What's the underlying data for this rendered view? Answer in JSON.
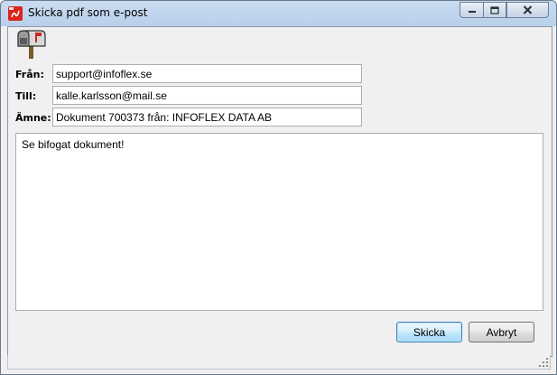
{
  "window": {
    "title": "Skicka pdf som e-post",
    "controls": {
      "minimize": "minimize-icon",
      "maximize": "maximize-icon",
      "close": "close-icon"
    }
  },
  "form": {
    "from_label": "Från:",
    "from_value": "support@infoflex.se",
    "to_label": "Till:",
    "to_value": "kalle.karlsson@mail.se",
    "subject_label": "Ämne:",
    "subject_value": "Dokument 700373 från: INFOFLEX DATA AB",
    "message": "Se bifogat dokument!"
  },
  "buttons": {
    "send": "Skicka",
    "cancel": "Avbryt"
  },
  "icons": {
    "app": "pdf-icon",
    "header": "mailbox-icon",
    "resize": "resize-grip-icon"
  },
  "colors": {
    "title_bar": "#b9d0ea",
    "dialog_bg": "#f0f0f0",
    "primary_button": "#bee6fd",
    "pdf_red": "#d9251c"
  }
}
